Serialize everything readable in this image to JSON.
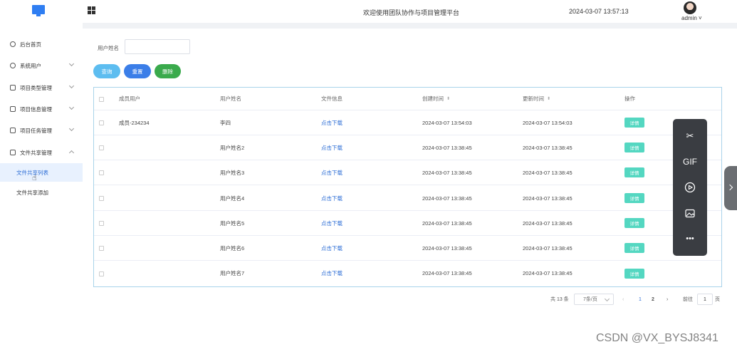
{
  "header": {
    "site_title": "欢迎使用团队协作与项目管理平台",
    "datetime": "2024-03-07 13:57:13",
    "username": "admin ˅"
  },
  "sidebar": {
    "items": [
      {
        "label": "后台首页",
        "icon": "dashboard-icon"
      },
      {
        "label": "系统用户",
        "icon": "user-icon"
      },
      {
        "label": "项目类型管理",
        "icon": "list-icon"
      },
      {
        "label": "项目信息管理",
        "icon": "list-icon"
      },
      {
        "label": "项目任务管理",
        "icon": "list-icon"
      },
      {
        "label": "文件共享管理",
        "icon": "list-icon"
      }
    ],
    "subitems": [
      {
        "label": "文件共享列表",
        "active": true
      },
      {
        "label": "文件共享添加",
        "active": false
      }
    ]
  },
  "search": {
    "label": "用户姓名",
    "value": "",
    "query_label": "查询",
    "reset_label": "重置",
    "delete_label": "删除"
  },
  "table": {
    "columns": [
      "成员用户",
      "用户姓名",
      "文件信息",
      "创建时间",
      "更新时间",
      "操作"
    ],
    "rows": [
      {
        "member": "成员-234234",
        "name": "李四",
        "file": "点击下载",
        "created": "2024-03-07 13:54:03",
        "updated": "2024-03-07 13:54:03",
        "action": "详情"
      },
      {
        "member": "",
        "name": "用户姓名2",
        "file": "点击下载",
        "created": "2024-03-07 13:38:45",
        "updated": "2024-03-07 13:38:45",
        "action": "详情"
      },
      {
        "member": "",
        "name": "用户姓名3",
        "file": "点击下载",
        "created": "2024-03-07 13:38:45",
        "updated": "2024-03-07 13:38:45",
        "action": "详情"
      },
      {
        "member": "",
        "name": "用户姓名4",
        "file": "点击下载",
        "created": "2024-03-07 13:38:45",
        "updated": "2024-03-07 13:38:45",
        "action": "详情"
      },
      {
        "member": "",
        "name": "用户姓名5",
        "file": "点击下载",
        "created": "2024-03-07 13:38:45",
        "updated": "2024-03-07 13:38:45",
        "action": "详情"
      },
      {
        "member": "",
        "name": "用户姓名6",
        "file": "点击下载",
        "created": "2024-03-07 13:38:45",
        "updated": "2024-03-07 13:38:45",
        "action": "详情"
      },
      {
        "member": "",
        "name": "用户姓名7",
        "file": "点击下载",
        "created": "2024-03-07 13:38:45",
        "updated": "2024-03-07 13:38:45",
        "action": "详情"
      }
    ]
  },
  "pagination": {
    "total": "共 13 条",
    "page_size": "7条/页",
    "prev": "‹",
    "pages": [
      "1",
      "2"
    ],
    "current": "1",
    "next": "›",
    "goto_label": "前往",
    "goto_value": "1",
    "page_unit": "页"
  },
  "float_toolbar": {
    "items": [
      "scissors-icon",
      "gif-icon",
      "video-record-icon",
      "image-icon",
      "more-icon"
    ],
    "gif_label": "GIF",
    "more_label": "•••"
  },
  "watermark": "CSDN @VX_BYSJ8341",
  "colors": {
    "accent": "#2f6fd6",
    "query_btn": "#5dbdf0",
    "reset_btn": "#3b7ee8",
    "delete_btn": "#3aaa4c",
    "detail_btn": "#54d7c1",
    "toolbar_bg": "#3a3d42"
  }
}
